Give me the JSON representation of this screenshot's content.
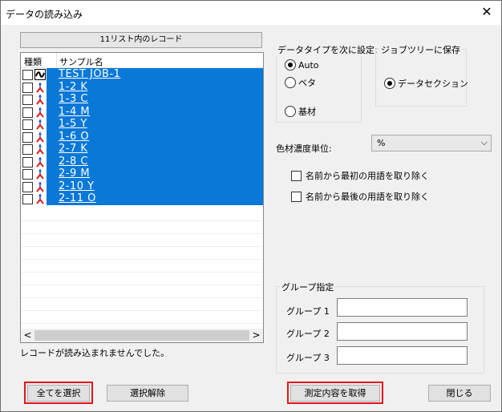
{
  "window": {
    "title": "データの読み込み",
    "close_symbol": "✕"
  },
  "list": {
    "header": "11リスト内のレコード",
    "col_type": "種類",
    "col_name": "サンプル名",
    "rows": [
      {
        "name": "TEST JOB-1",
        "icon": "job-icon"
      },
      {
        "name": "1-2 K",
        "icon": "sample-icon"
      },
      {
        "name": "1-3 C",
        "icon": "sample-icon"
      },
      {
        "name": "1-4 M",
        "icon": "sample-icon"
      },
      {
        "name": "1-5 Y",
        "icon": "sample-icon"
      },
      {
        "name": "1-6 O",
        "icon": "sample-icon"
      },
      {
        "name": "2-7 K",
        "icon": "sample-icon"
      },
      {
        "name": "2-8 C",
        "icon": "sample-icon"
      },
      {
        "name": "2-9 M",
        "icon": "sample-icon"
      },
      {
        "name": "2-10 Y",
        "icon": "sample-icon"
      },
      {
        "name": "2-11 O",
        "icon": "sample-icon"
      }
    ],
    "scroll_left": "<",
    "scroll_right": ">"
  },
  "status": "レコードが読み込まれませんでした。",
  "datatype": {
    "label": "データタイプを次に設定:",
    "opt_auto": "Auto",
    "opt_solid": "ベタ",
    "opt_substrate": "基材",
    "selected": "Auto"
  },
  "jobtree": {
    "label": "ジョブツリーに保存",
    "opt_data_section": "データセクション"
  },
  "density": {
    "label": "色材濃度単位:",
    "value": "%",
    "arrow": "⌵"
  },
  "options": {
    "remove_first": "名前から最初の用語を取り除く",
    "remove_last": "名前から最後の用語を取り除く"
  },
  "group": {
    "label": "グループ指定",
    "g1": "グループ 1",
    "g2": "グループ 2",
    "g3": "グループ 3"
  },
  "buttons": {
    "select_all": "全てを選択",
    "deselect": "選択解除",
    "get_measurement": "測定内容を取得",
    "close": "閉じる"
  },
  "colors": {
    "selection": "#0a78d7",
    "highlight": "#e0161e",
    "sample_icon_red": "#d42020",
    "sample_icon_blue": "#2a4ec8"
  }
}
